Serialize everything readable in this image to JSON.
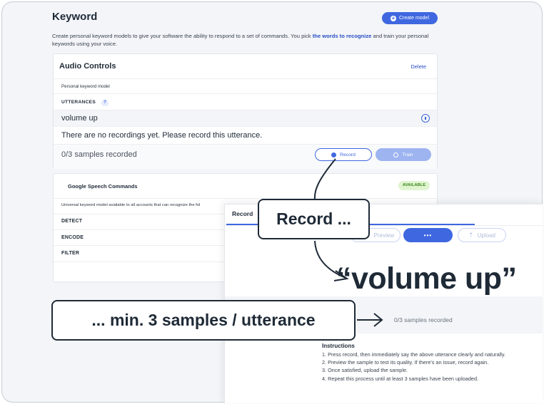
{
  "page": {
    "title": "Keyword",
    "create_button": "Create model",
    "intro_part1": "Create personal keyword models to give your software the ability to respond to a set of commands. You pick ",
    "intro_link": "the words to recognize",
    "intro_part2": " and train your personal keywords using your voice."
  },
  "audio_controls": {
    "title": "Audio Controls",
    "delete_label": "Delete",
    "model_type": "Personal keyword model",
    "utterances_label": "UTTERANCES",
    "help_mark": "?",
    "utterance": "volume up",
    "no_recordings": "There are no recordings yet. Please record this utterance.",
    "samples_status": "0/3 samples recorded",
    "record_label": "Record",
    "train_label": "Train"
  },
  "speech_commands": {
    "title": "Google Speech Commands",
    "badge": "AVAILABLE",
    "description": "Universal keyword model available to all accounts that can recognize the fol",
    "sections": [
      "DETECT",
      "ENCODE",
      "FILTER"
    ]
  },
  "record_panel": {
    "tab_label": "Record",
    "preview_label": "Preview",
    "record_label": "•••",
    "upload_label": "Upload",
    "phrase": "“volume up”",
    "samples_status": "0/3 samples recorded",
    "instructions_title": "Instructions",
    "instructions": [
      "1. Press record, then immediately say the above utterance clearly and naturally.",
      "2. Preview the sample to test its quality. If there's an issue, record again.",
      "3. Once satisfied, upload the sample.",
      "4. Repeat this process until at least 3 samples have been uploaded."
    ]
  },
  "callouts": {
    "record": "Record ...",
    "samples": "... min. 3 samples / utterance"
  },
  "colors": {
    "accent": "#3f67e0",
    "available_bg": "#dff4cf",
    "text_dark": "#1f2a37"
  }
}
